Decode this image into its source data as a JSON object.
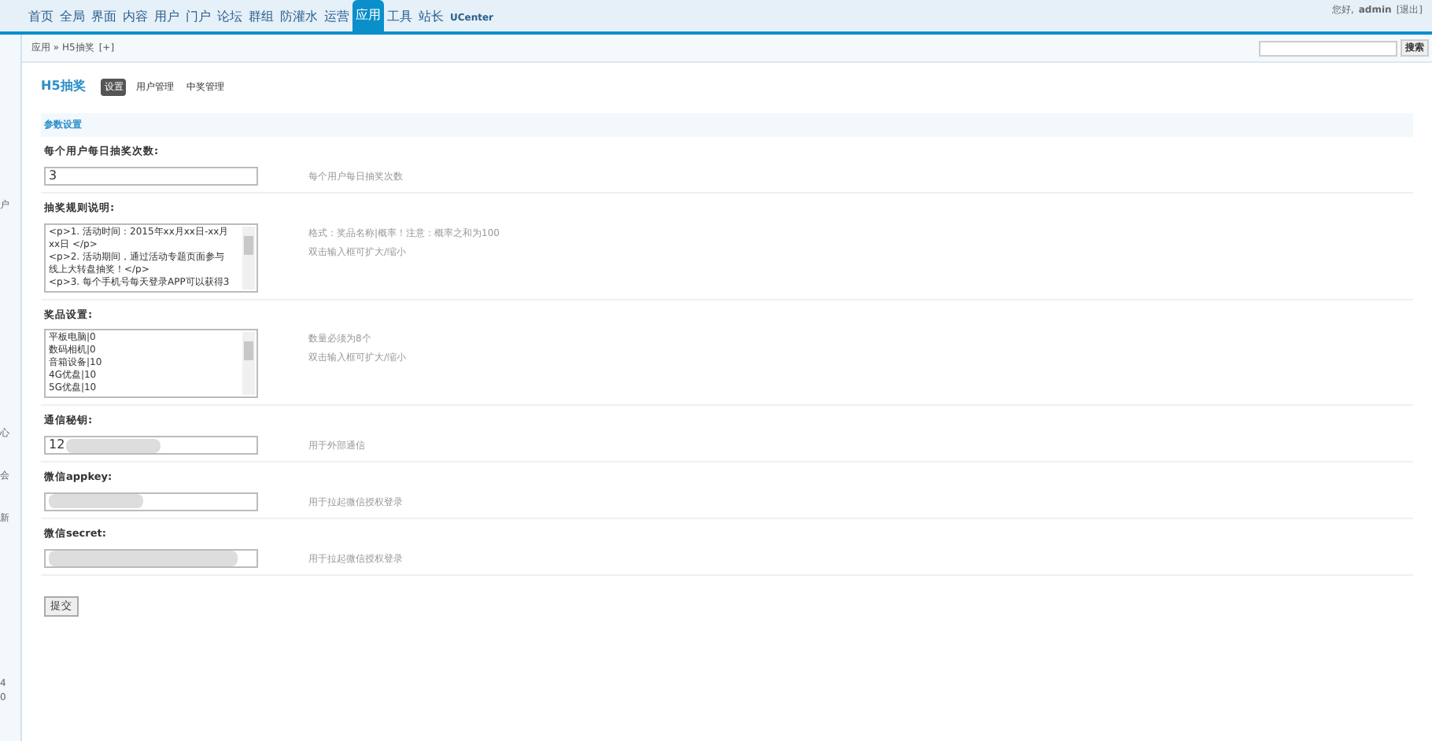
{
  "top_nav": {
    "tabs": [
      {
        "label": "首页",
        "selected": false
      },
      {
        "label": "全局",
        "selected": false
      },
      {
        "label": "界面",
        "selected": false
      },
      {
        "label": "内容",
        "selected": false
      },
      {
        "label": "用户",
        "selected": false
      },
      {
        "label": "门户",
        "selected": false
      },
      {
        "label": "论坛",
        "selected": false
      },
      {
        "label": "群组",
        "selected": false
      },
      {
        "label": "防灌水",
        "selected": false
      },
      {
        "label": "运营",
        "selected": false
      },
      {
        "label": "应用",
        "selected": true
      },
      {
        "label": "工具",
        "selected": false
      },
      {
        "label": "站长",
        "selected": false
      },
      {
        "label": "UCenter",
        "selected": false
      }
    ],
    "greeting": "您好,",
    "username": "admin",
    "logout": "[退出]"
  },
  "breadcrumb": {
    "text": "应用 » H5抽奖",
    "add": "[+]"
  },
  "search": {
    "button": "搜索"
  },
  "sidebar": {
    "fragments": [
      "户",
      "心",
      "会",
      "新",
      "4",
      "0"
    ]
  },
  "plugin": {
    "title": "H5抽奖",
    "tabs": [
      {
        "label": "设置",
        "selected": true
      },
      {
        "label": "用户管理",
        "selected": false
      },
      {
        "label": "中奖管理",
        "selected": false
      }
    ]
  },
  "section_title": "参数设置",
  "settings": [
    {
      "kind": "input",
      "label": "每个用户每日抽奖次数:",
      "value": "3",
      "hints": [
        "每个用户每日抽奖次数"
      ]
    },
    {
      "kind": "textarea",
      "label": "抽奖规则说明:",
      "lines": [
        "<p>1. 活动时间：2015年xx月xx日-xx月",
        "xx日 </p>",
        "<p>2. 活动期间，通过活动专题页面参与",
        "线上大转盘抽奖！</p>",
        "<p>3. 每个手机号每天登录APP可以获得3"
      ],
      "hints": [
        "格式：奖品名称|概率！注意：概率之和为100",
        "双击输入框可扩大/缩小"
      ]
    },
    {
      "kind": "textarea",
      "label": "奖品设置:",
      "lines": [
        "平板电脑|0",
        "数码相机|0",
        "音箱设备|10",
        "4G优盘|10",
        "5G优盘|10"
      ],
      "hints": [
        "数量必须为8个",
        "双击输入框可扩大/缩小"
      ]
    },
    {
      "kind": "redacted",
      "label": "通信秘钥:",
      "value": "12",
      "hints": [
        "用于外部通信"
      ]
    },
    {
      "kind": "redacted",
      "label": "微信appkey:",
      "hints": [
        "用于拉起微信授权登录"
      ]
    },
    {
      "kind": "redacted",
      "label": "微信secret:",
      "hints": [
        "用于拉起微信授权登录"
      ]
    }
  ],
  "submit": "提交"
}
